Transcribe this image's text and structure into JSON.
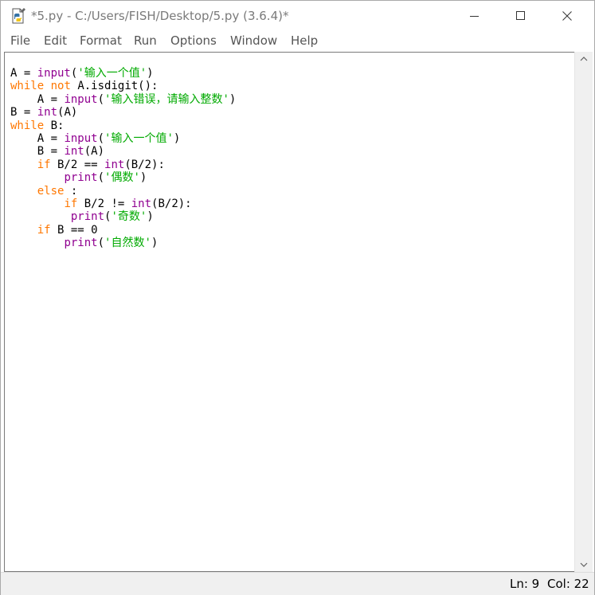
{
  "window": {
    "title": "*5.py - C:/Users/FISH/Desktop/5.py (3.6.4)*",
    "icon": "python-file-icon"
  },
  "controls": {
    "minimize": "minimize-icon",
    "maximize": "maximize-icon",
    "close": "close-icon"
  },
  "menu": {
    "file": "File",
    "edit": "Edit",
    "format": "Format",
    "run": "Run",
    "options": "Options",
    "window": "Window",
    "help": "Help"
  },
  "code": {
    "lines": [
      [
        {
          "t": "A = ",
          "c": "plain"
        },
        {
          "t": "input",
          "c": "builtin"
        },
        {
          "t": "(",
          "c": "plain"
        },
        {
          "t": "'输入一个值'",
          "c": "string"
        },
        {
          "t": ")",
          "c": "plain"
        }
      ],
      [
        {
          "t": "while",
          "c": "keyword"
        },
        {
          "t": " ",
          "c": "plain"
        },
        {
          "t": "not",
          "c": "keyword"
        },
        {
          "t": " A.isdigit():",
          "c": "plain"
        }
      ],
      [
        {
          "t": "    A = ",
          "c": "plain"
        },
        {
          "t": "input",
          "c": "builtin"
        },
        {
          "t": "(",
          "c": "plain"
        },
        {
          "t": "'输入错误，请输入整数'",
          "c": "string"
        },
        {
          "t": ")",
          "c": "plain"
        }
      ],
      [
        {
          "t": "B = ",
          "c": "plain"
        },
        {
          "t": "int",
          "c": "builtin"
        },
        {
          "t": "(A)",
          "c": "plain"
        }
      ],
      [
        {
          "t": "while",
          "c": "keyword"
        },
        {
          "t": " B:",
          "c": "plain"
        }
      ],
      [
        {
          "t": "    A = ",
          "c": "plain"
        },
        {
          "t": "input",
          "c": "builtin"
        },
        {
          "t": "(",
          "c": "plain"
        },
        {
          "t": "'输入一个值'",
          "c": "string"
        },
        {
          "t": ")",
          "c": "plain"
        }
      ],
      [
        {
          "t": "    B = ",
          "c": "plain"
        },
        {
          "t": "int",
          "c": "builtin"
        },
        {
          "t": "(A)",
          "c": "plain"
        }
      ],
      [
        {
          "t": "    ",
          "c": "plain"
        },
        {
          "t": "if",
          "c": "keyword"
        },
        {
          "t": " B/2 == ",
          "c": "plain"
        },
        {
          "t": "int",
          "c": "builtin"
        },
        {
          "t": "(B/2):",
          "c": "plain"
        }
      ],
      [
        {
          "t": "        ",
          "c": "plain"
        },
        {
          "t": "print",
          "c": "builtin"
        },
        {
          "t": "(",
          "c": "plain"
        },
        {
          "t": "'偶数'",
          "c": "string"
        },
        {
          "t": ")",
          "c": "plain"
        }
      ],
      [
        {
          "t": "    ",
          "c": "plain"
        },
        {
          "t": "else",
          "c": "keyword"
        },
        {
          "t": " :",
          "c": "plain"
        }
      ],
      [
        {
          "t": "        ",
          "c": "plain"
        },
        {
          "t": "if",
          "c": "keyword"
        },
        {
          "t": " B/2 != ",
          "c": "plain"
        },
        {
          "t": "int",
          "c": "builtin"
        },
        {
          "t": "(B/2):",
          "c": "plain"
        }
      ],
      [
        {
          "t": "         ",
          "c": "plain"
        },
        {
          "t": "print",
          "c": "builtin"
        },
        {
          "t": "(",
          "c": "plain"
        },
        {
          "t": "'奇数'",
          "c": "string"
        },
        {
          "t": ")",
          "c": "plain"
        }
      ],
      [
        {
          "t": "    ",
          "c": "plain"
        },
        {
          "t": "if",
          "c": "keyword"
        },
        {
          "t": " B == 0",
          "c": "plain"
        }
      ],
      [
        {
          "t": "        ",
          "c": "plain"
        },
        {
          "t": "print",
          "c": "builtin"
        },
        {
          "t": "(",
          "c": "plain"
        },
        {
          "t": "'自然数'",
          "c": "string"
        },
        {
          "t": ")",
          "c": "plain"
        }
      ]
    ]
  },
  "colors": {
    "keyword": "#ff7700",
    "builtin": "#900090",
    "string": "#00aa00",
    "plain": "#000000"
  },
  "status": {
    "line": "Ln: 9",
    "col": "Col: 22"
  }
}
